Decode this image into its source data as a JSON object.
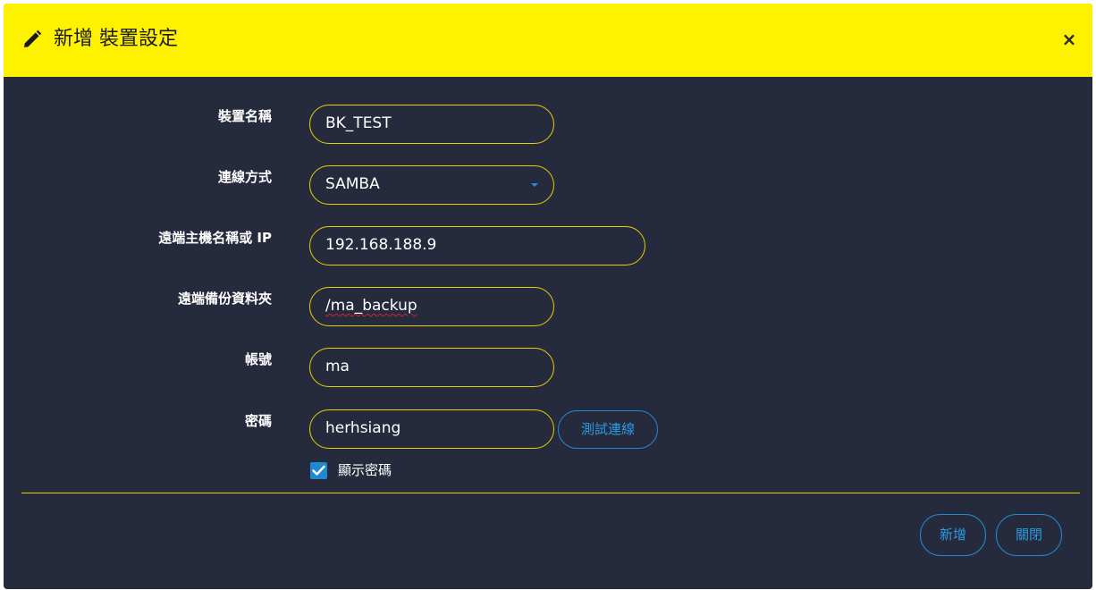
{
  "dialog": {
    "title": "新增 裝置設定",
    "title_icon": "pencil-icon",
    "close_label": "×"
  },
  "form": {
    "device_name": {
      "label": "裝置名稱",
      "value": "BK_TEST"
    },
    "connection_method": {
      "label": "連線方式",
      "value": "SAMBA"
    },
    "remote_host": {
      "label": "遠端主機名稱或 IP",
      "value": "192.168.188.9"
    },
    "remote_folder": {
      "label": "遠端備份資料夾",
      "value": "/ma_backup"
    },
    "account": {
      "label": "帳號",
      "value": "ma"
    },
    "password": {
      "label": "密碼",
      "value": "herhsiang"
    },
    "test_connection_label": "測試連線",
    "show_password": {
      "label": "顯示密碼",
      "checked": true
    }
  },
  "footer": {
    "add_label": "新增",
    "close_label": "關閉"
  },
  "colors": {
    "title_bg": "#fff200",
    "dialog_bg": "#262a3d",
    "field_border": "#e6d000",
    "accent_blue": "#1f8ad0"
  }
}
